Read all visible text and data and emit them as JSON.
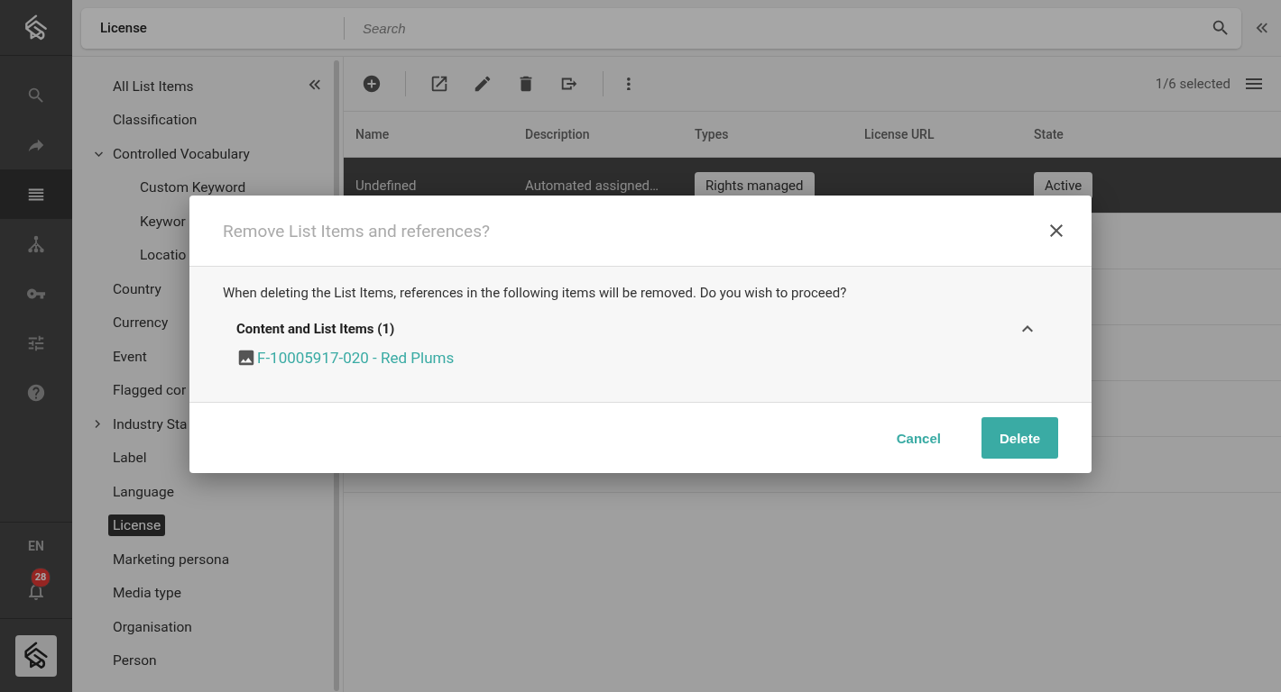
{
  "app_bar": {
    "title": "License",
    "search": {
      "placeholder": "Search"
    }
  },
  "rail": {
    "items": [
      {
        "selected": false
      },
      {
        "selected": false
      },
      {
        "selected": true
      },
      {
        "selected": false
      },
      {
        "selected": false
      },
      {
        "selected": false
      },
      {
        "selected": false
      }
    ],
    "language": "EN",
    "notification_count": "28"
  },
  "sidebar": {
    "items": [
      {
        "label": "All List Items",
        "selected": false
      },
      {
        "label": "Classification",
        "selected": false
      },
      {
        "label": "Controlled Vocabulary",
        "selected": false,
        "expanded": true,
        "children": [
          {
            "label": "Custom Keyword",
            "selected": false
          },
          {
            "label": "Keywor",
            "selected": false
          },
          {
            "label": "Locatio",
            "selected": false
          }
        ]
      },
      {
        "label": "Country",
        "selected": false
      },
      {
        "label": "Currency",
        "selected": false
      },
      {
        "label": "Event",
        "selected": false
      },
      {
        "label": "Flagged cor",
        "selected": false
      },
      {
        "label": "Industry Sta",
        "selected": false,
        "expanded": false
      },
      {
        "label": "Label",
        "selected": false
      },
      {
        "label": "Language",
        "selected": false
      },
      {
        "label": "License",
        "selected": true
      },
      {
        "label": "Marketing persona",
        "selected": false
      },
      {
        "label": "Media type",
        "selected": false
      },
      {
        "label": "Organisation",
        "selected": false
      },
      {
        "label": "Person",
        "selected": false
      }
    ]
  },
  "toolbar": {
    "selection": "1/6 selected"
  },
  "table": {
    "columns": [
      "Name",
      "Description",
      "Types",
      "License URL",
      "State"
    ],
    "rows": [
      {
        "selected": true,
        "name": "Undefined",
        "description": "Automated assigned…",
        "types": [
          "Rights managed"
        ],
        "state": "Active"
      }
    ]
  },
  "dialog": {
    "title": "Remove List Items and references?",
    "message": "When deleting the List Items, references in the following items will be removed. Do you wish to proceed?",
    "section": {
      "title": "Content and List Items (1)",
      "expanded": true,
      "items": [
        {
          "label": "F-10005917-020 - Red Plums"
        }
      ]
    },
    "buttons": [
      {
        "label": "Cancel",
        "kind": "text"
      },
      {
        "label": "Delete",
        "kind": "primary"
      }
    ]
  }
}
